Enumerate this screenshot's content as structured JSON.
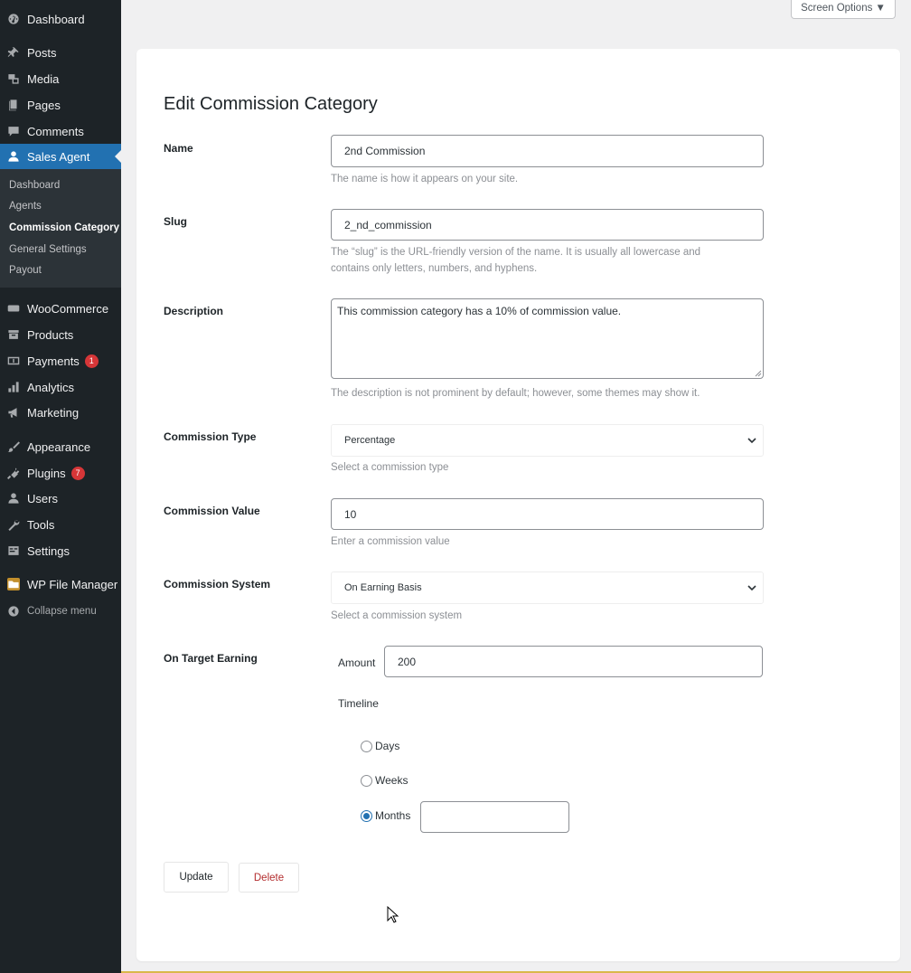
{
  "sidebar": {
    "top_items": [
      {
        "label": "Dashboard",
        "icon": "dashboard-icon"
      },
      {
        "label": "Posts",
        "icon": "pin-icon"
      },
      {
        "label": "Media",
        "icon": "media-icon"
      },
      {
        "label": "Pages",
        "icon": "pages-icon"
      },
      {
        "label": "Comments",
        "icon": "comment-icon"
      },
      {
        "label": "Sales Agent",
        "icon": "user-icon"
      }
    ],
    "submenu": [
      "Dashboard",
      "Agents",
      "Commission Category",
      "General Settings",
      "Payout"
    ],
    "current_submenu": "Commission Category",
    "items": [
      {
        "label": "WooCommerce",
        "icon": "woo-icon"
      },
      {
        "label": "Products",
        "icon": "archive-icon"
      },
      {
        "label": "Payments",
        "icon": "money-icon",
        "badge": "1"
      },
      {
        "label": "Analytics",
        "icon": "chart-icon"
      },
      {
        "label": "Marketing",
        "icon": "megaphone-icon"
      },
      {
        "label": "Appearance",
        "icon": "brush-icon"
      },
      {
        "label": "Plugins",
        "icon": "plug-icon",
        "badge": "7"
      },
      {
        "label": "Users",
        "icon": "users-icon"
      },
      {
        "label": "Tools",
        "icon": "wrench-icon"
      },
      {
        "label": "Settings",
        "icon": "settings-icon"
      },
      {
        "label": "WP File Manager",
        "icon": "folder-icon"
      },
      {
        "label": "Collapse menu",
        "icon": "collapse-icon"
      }
    ]
  },
  "screen_options": "Screen Options ▼",
  "form": {
    "title": "Edit Commission Category",
    "name": {
      "label": "Name",
      "value": "2nd Commission",
      "help": "The name is how it appears on your site."
    },
    "slug": {
      "label": "Slug",
      "value": "2_nd_commission",
      "help1": "The “slug” is the URL-friendly version of the name. It is usually all lowercase and",
      "help2": "contains only letters, numbers, and hyphens."
    },
    "description": {
      "label": "Description",
      "value": "This commission category has a 10% of commission value.",
      "help": "The description is not prominent by default; however, some themes may show it."
    },
    "commission_type": {
      "label": "Commission Type",
      "value": "Percentage",
      "help": "Select a commission type"
    },
    "commission_value": {
      "label": "Commission Value",
      "value": "10",
      "help": "Enter a commission value"
    },
    "commission_system": {
      "label": "Commission System",
      "value": "On Earning Basis",
      "help": "Select a commission system"
    },
    "ote": {
      "label": "On Target Earning",
      "amount_label": "Amount",
      "amount_value": "200",
      "timeline_label": "Timeline",
      "options": [
        "Days",
        "Weeks",
        "Months"
      ],
      "selected": "Months",
      "months_value": ""
    },
    "update_label": "Update",
    "delete_label": "Delete"
  },
  "colors": {
    "sidebar_bg": "#1d2327",
    "active_bg": "#2271b1",
    "badge": "#d63638",
    "delete": "#b32d2e"
  }
}
